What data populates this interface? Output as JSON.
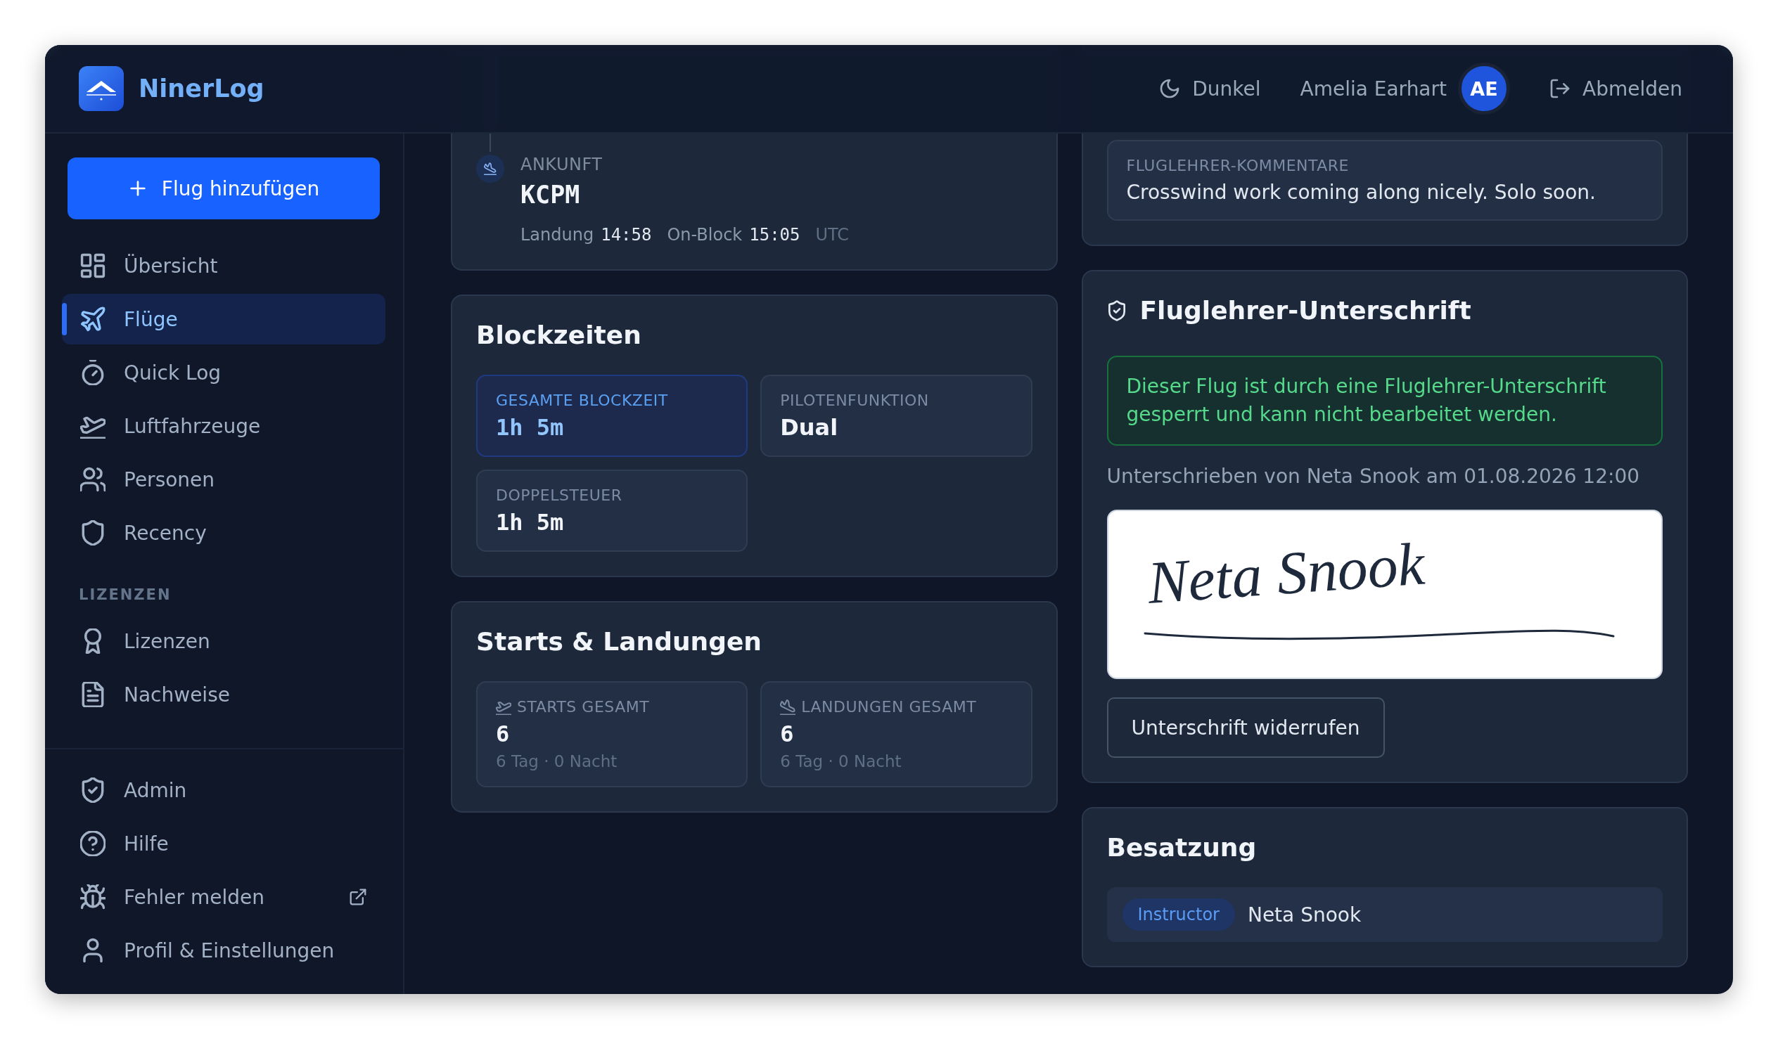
{
  "app": {
    "name": "NinerLog"
  },
  "header": {
    "theme_toggle": "Dunkel",
    "user_name": "Amelia Earhart",
    "user_initials": "AE",
    "logout": "Abmelden"
  },
  "sidebar": {
    "add_button": "Flug hinzufügen",
    "nav": [
      {
        "label": "Übersicht",
        "selected": false
      },
      {
        "label": "Flüge",
        "selected": true
      },
      {
        "label": "Quick Log",
        "selected": false
      },
      {
        "label": "Luftfahrzeuge",
        "selected": false
      },
      {
        "label": "Personen",
        "selected": false
      },
      {
        "label": "Recency",
        "selected": false
      }
    ],
    "sections": [
      {
        "title": "LIZENZEN",
        "items": [
          {
            "label": "Lizenzen",
            "selected": false
          },
          {
            "label": "Nachweise",
            "selected": false
          }
        ]
      }
    ],
    "footer_items": [
      {
        "label": "Admin",
        "selected": false,
        "external": false
      },
      {
        "label": "Hilfe",
        "selected": false,
        "external": false
      },
      {
        "label": "Fehler melden",
        "selected": false,
        "external": true
      },
      {
        "label": "Profil & Einstellungen",
        "selected": false,
        "external": false
      }
    ]
  },
  "flight_route": {
    "stops": [
      {
        "kind": "arrival",
        "label": "ANKUNFT",
        "airport": "KCPM",
        "times": [
          {
            "label": "Landung",
            "value": "14:58"
          },
          {
            "label": "On-Block",
            "value": "15:05"
          }
        ],
        "timezone": "UTC"
      }
    ]
  },
  "block_times": {
    "title": "Blockzeiten",
    "tiles": [
      {
        "kind": "duration",
        "label": "GESAMTE BLOCKZEIT",
        "value": "1h 5m",
        "highlighted": true
      },
      {
        "kind": "text",
        "label": "PILOTENFUNKTION",
        "value": "Dual",
        "highlighted": false
      },
      {
        "kind": "duration",
        "label": "DOPPELSTEUER",
        "value": "1h 5m",
        "highlighted": false
      }
    ]
  },
  "takeoffs_landings": {
    "title": "Starts & Landungen",
    "tiles": [
      {
        "kind": "takeoff",
        "label": "STARTS GESAMT",
        "value": "6",
        "detail": "6 Tag · 0 Nacht"
      },
      {
        "kind": "landing",
        "label": "LANDUNGEN GESAMT",
        "value": "6",
        "detail": "6 Tag · 0 Nacht"
      }
    ]
  },
  "instructor_comments": {
    "label": "FLUGLEHRER-KOMMENTARE",
    "text": "Crosswind work coming along nicely. Solo soon."
  },
  "signature": {
    "title": "Fluglehrer-Unterschrift",
    "locked_notice": "Dieser Flug ist durch eine Fluglehrer-Unterschrift gesperrt und kann nicht bearbeitet werden.",
    "signed_by": "Unterschrieben von Neta Snook am 01.08.2026 12:00",
    "signature_text": "Neta Snook",
    "revoke_button": "Unterschrift widerrufen"
  },
  "crew": {
    "title": "Besatzung",
    "members": [
      {
        "role": "Instructor",
        "name": "Neta Snook"
      }
    ]
  }
}
